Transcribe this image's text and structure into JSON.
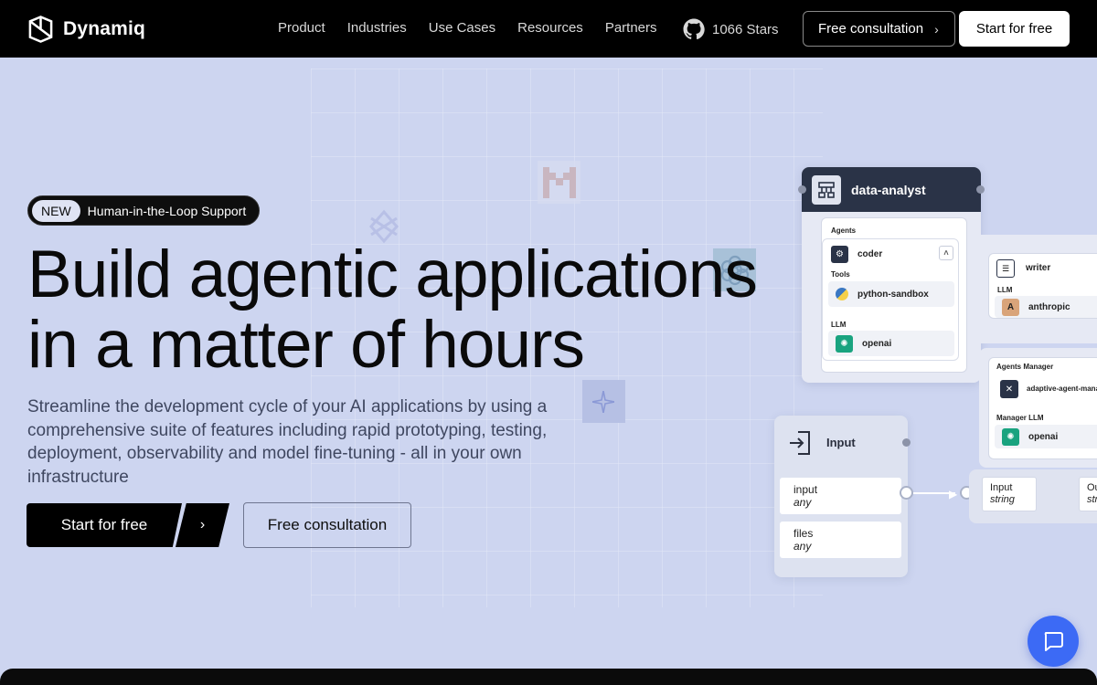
{
  "nav": {
    "logo_text": "Dynamiq",
    "links": [
      "Product",
      "Industries",
      "Use Cases",
      "Resources",
      "Partners"
    ],
    "stars": "1066 Stars",
    "consult_label": "Free consultation",
    "start_label": "Start for free"
  },
  "hero": {
    "badge_new": "NEW",
    "badge_text": "Human-in-the-Loop Support",
    "title_line1": "Build agentic applications",
    "title_line2": "in a matter of hours",
    "description": "Streamline the development cycle of your AI applications by using a comprehensive suite of features including rapid prototyping, testing, deployment, observability and model fine-tuning - all in your own infrastructure",
    "start_label": "Start for free",
    "consult_label": "Free consultation"
  },
  "diagram": {
    "data_analyst": {
      "title": "data-analyst",
      "agents_label": "Agents",
      "agent": "coder",
      "tools_label": "Tools",
      "tool": "python-sandbox",
      "llm_label": "LLM",
      "llm": "openai"
    },
    "writer": {
      "title": "writer",
      "llm_label": "LLM",
      "llm": "anthropic"
    },
    "manager": {
      "label": "Agents Manager",
      "name": "adaptive-agent-mana",
      "llm_label": "Manager LLM",
      "llm": "openai"
    },
    "input_node": {
      "title": "Input",
      "rows": [
        {
          "name": "input",
          "type": "any"
        },
        {
          "name": "files",
          "type": "any"
        }
      ]
    },
    "output_node": {
      "in_label": "Input",
      "in_type": "string",
      "out_label": "Ou",
      "out_type": "stri"
    }
  },
  "colors": {
    "background": "#cdd5f0",
    "nav": "#000000",
    "chat_button": "#3c6af5"
  }
}
